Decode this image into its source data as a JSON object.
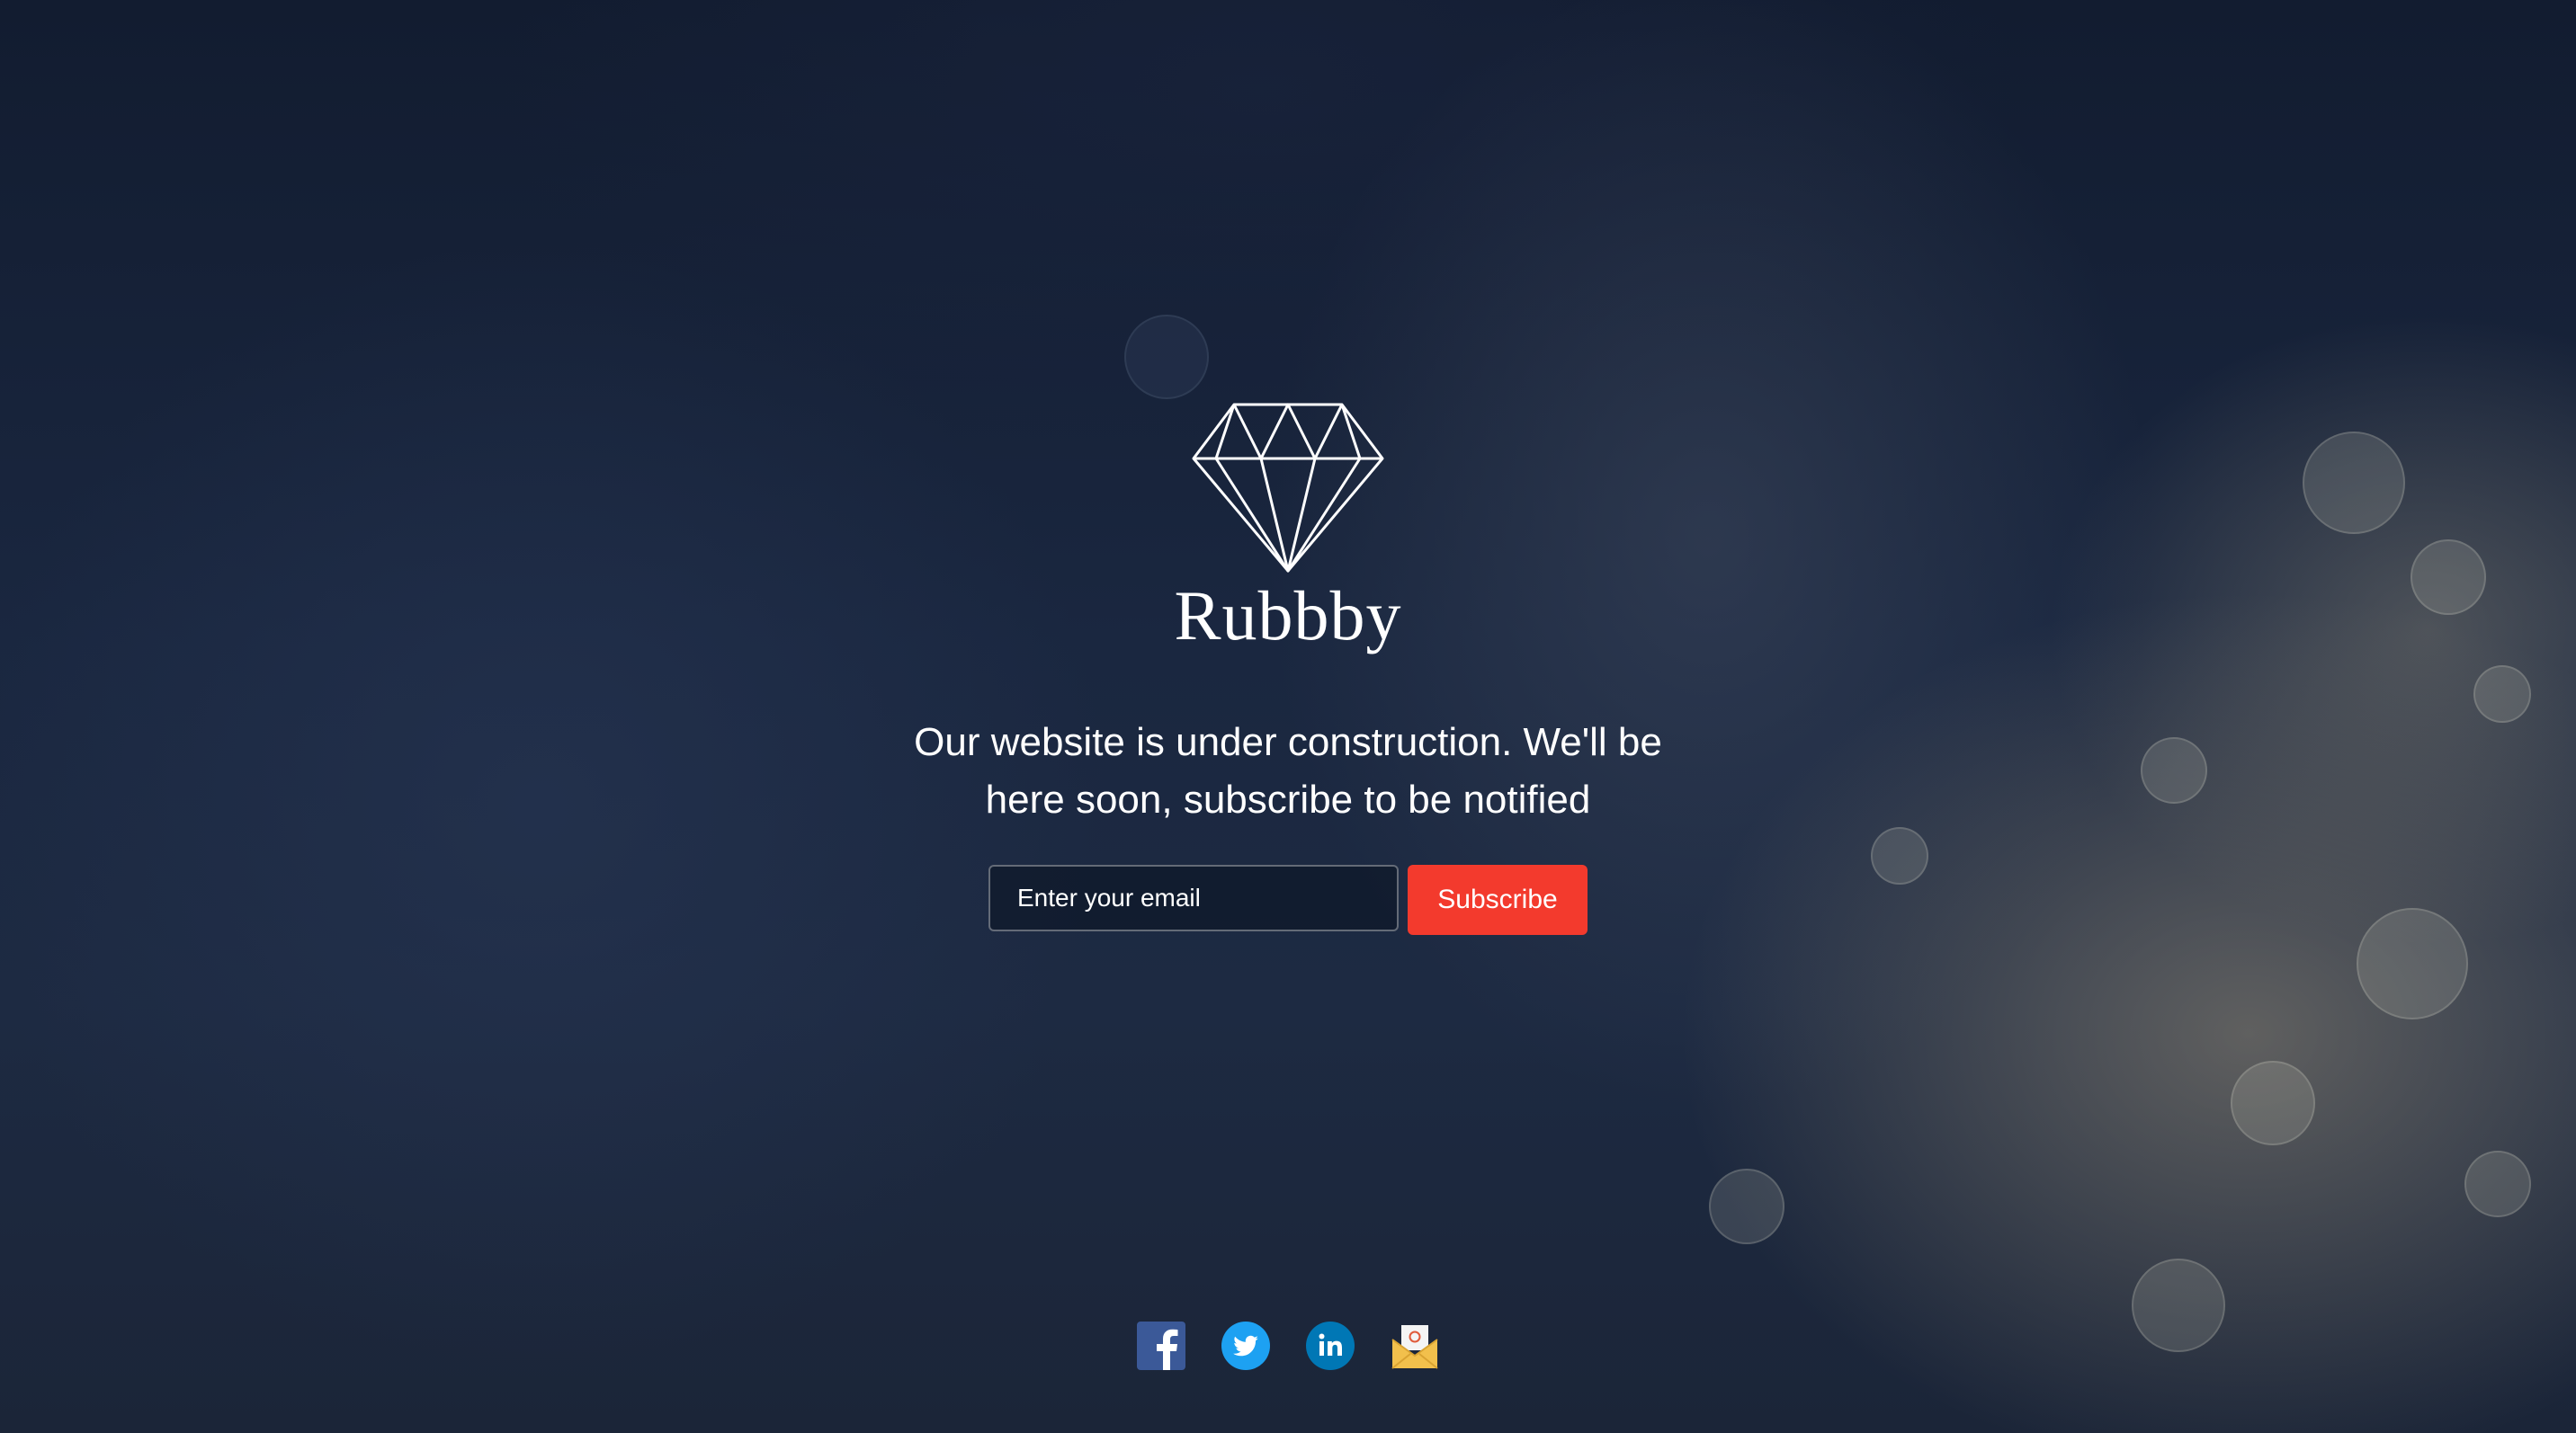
{
  "brand": {
    "name": "Rubbby",
    "logo_icon": "diamond-icon"
  },
  "tagline": "Our website is under construction. We'll be here soon, subscribe to be notified",
  "subscribe_form": {
    "email_placeholder": "Enter your email",
    "email_value": "",
    "button_label": "Subscribe"
  },
  "social_links": [
    {
      "icon": "facebook-icon",
      "color": "#3b5998"
    },
    {
      "icon": "twitter-icon",
      "color": "#1da1f2"
    },
    {
      "icon": "linkedin-icon",
      "color": "#0077b5"
    },
    {
      "icon": "email-icon",
      "color": "#f2c04c"
    }
  ],
  "colors": {
    "accent": "#f33a2d",
    "text": "#ffffff",
    "background": "#1a2740"
  }
}
